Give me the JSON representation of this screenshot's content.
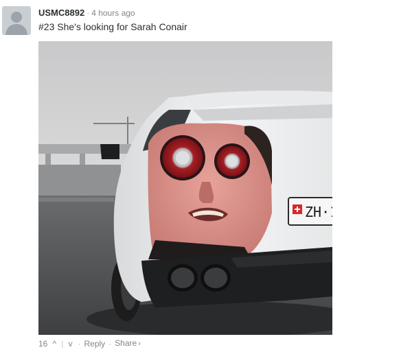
{
  "comment": {
    "username": "USMC8892",
    "separator": "·",
    "timestamp": "4 hours ago",
    "text": "#23 She's looking for Sarah Conair",
    "plate_text": "ZH·1",
    "footer": {
      "vote_count": "16",
      "upvote_icon": "^",
      "downvote_icon": "v",
      "divider": "|",
      "dot": "·",
      "reply_label": "Reply",
      "share_label": "Share",
      "share_chevron": "›"
    }
  },
  "colors": {
    "text": "#2a2e2e",
    "muted": "#7f868a",
    "avatar_bg": "#c9ced2"
  }
}
